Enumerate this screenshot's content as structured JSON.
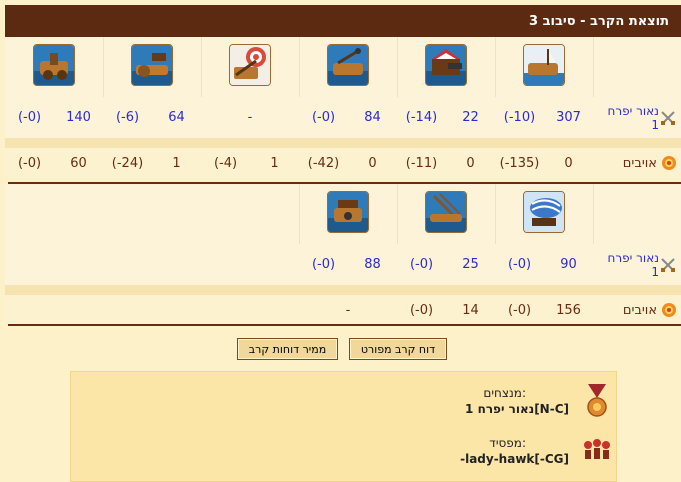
{
  "header": {
    "title": "תוצאת הקרב - סיבוב 3"
  },
  "player_name": "נאור יפרח 1",
  "enemy_label": "אויבים",
  "round1": {
    "units": [
      "ship-ram-icon",
      "ship-flamethrower-icon",
      "ship-ballista-icon",
      "ship-catapult-icon",
      "ship-paddle-icon",
      "ship-mortar-icon"
    ],
    "player": [
      {
        "v": "307",
        "l": "(-10)"
      },
      {
        "v": "22",
        "l": "(-14)"
      },
      {
        "v": "84",
        "l": "(-0)"
      },
      {
        "v": "-",
        "l": ""
      },
      {
        "v": "64",
        "l": "(-6)"
      },
      {
        "v": "140",
        "l": "(-0)"
      }
    ],
    "enemy": [
      {
        "v": "0",
        "l": "(-135)"
      },
      {
        "v": "0",
        "l": "(-11)"
      },
      {
        "v": "0",
        "l": "(-42)"
      },
      {
        "v": "1",
        "l": "(-4)"
      },
      {
        "v": "1",
        "l": "(-24)"
      },
      {
        "v": "60",
        "l": "(-0)"
      }
    ]
  },
  "round2": {
    "units": [
      "ship-steam-ram-icon",
      "ship-diving-boat-icon",
      "ship-rocket-icon"
    ],
    "player": [
      {
        "v": "90",
        "l": "(-0)"
      },
      {
        "v": "25",
        "l": "(-0)"
      },
      {
        "v": "88",
        "l": "(-0)"
      }
    ],
    "enemy": [
      {
        "v": "156",
        "l": "(-0)"
      },
      {
        "v": "14",
        "l": "(-0)"
      },
      {
        "v": "-",
        "l": ""
      }
    ]
  },
  "buttons": {
    "detailed": "דוח קרב מפורט",
    "summary": "ממיר דוחות קרב"
  },
  "result": {
    "winners_label": "מנצחים:",
    "winners_value": "נאור יפרח 1[N-C]",
    "losers_label": "מפסיד:",
    "losers_value": "-lady-hawk[-CG]"
  },
  "colors": {
    "header_bg": "#5c2a10",
    "player_text": "#2b2bd2",
    "enemy_text": "#6a2a10"
  }
}
